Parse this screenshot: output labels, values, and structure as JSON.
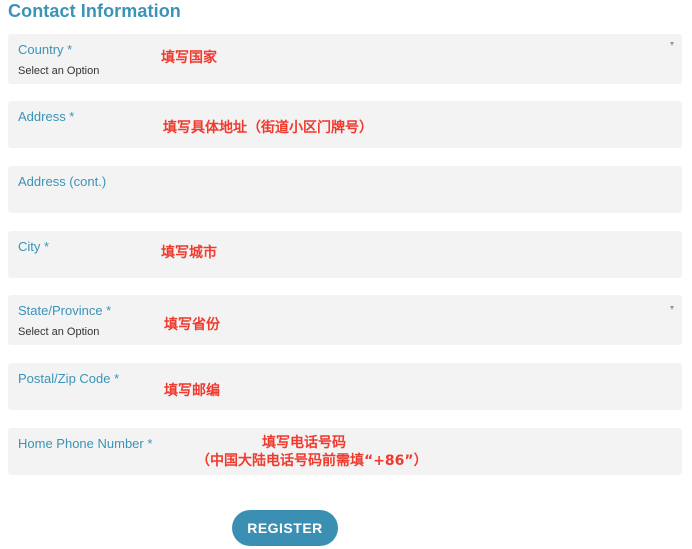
{
  "section_title": "Contact Information",
  "fields": {
    "country": {
      "label": "Country *",
      "value": "Select an Option",
      "note": "填写国家"
    },
    "address": {
      "label": "Address *",
      "note": "填写具体地址（街道小区门牌号）"
    },
    "address_cont": {
      "label": "Address (cont.)"
    },
    "city": {
      "label": "City *",
      "note": "填写城市"
    },
    "state": {
      "label": "State/Province *",
      "value": "Select an Option",
      "note": "填写省份"
    },
    "postal": {
      "label": "Postal/Zip Code *",
      "note": "填写邮编"
    },
    "phone": {
      "label": "Home Phone Number *",
      "note_line1": "填写电话号码",
      "note_line2": "（中国大陆电话号码前需填“+86”）"
    }
  },
  "register_label": "REGISTER",
  "colors": {
    "accent": "#3b93b8",
    "field_bg": "#f3f3f3",
    "note": "#f03a2e",
    "button": "#3a8fb3"
  },
  "icons": {
    "dropdown": "chevron-down-icon"
  }
}
